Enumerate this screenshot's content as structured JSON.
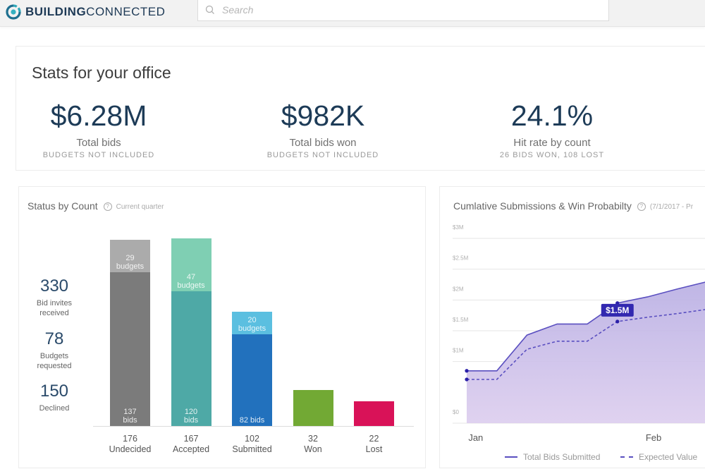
{
  "app": {
    "brand_bold": "BUILDING",
    "brand_light": "CONNECTED",
    "brand_color": "#1e3a56",
    "search_placeholder": "Search"
  },
  "stats": {
    "title": "Stats for your office",
    "items": [
      {
        "value": "$6.28M",
        "label": "Total bids",
        "sub": "BUDGETS NOT INCLUDED"
      },
      {
        "value": "$982K",
        "label": "Total bids won",
        "sub": "BUDGETS NOT INCLUDED"
      },
      {
        "value": "24.1%",
        "label": "Hit rate by count",
        "sub": "26 BIDS WON, 108 LOST"
      }
    ]
  },
  "status_card": {
    "title": "Status by Count",
    "help": "?",
    "subtitle": "Current quarter",
    "side_stats": [
      {
        "value": "330",
        "label_1": "Bid invites",
        "label_2": "received"
      },
      {
        "value": "78",
        "label_1": "Budgets",
        "label_2": "requested"
      },
      {
        "value": "150",
        "label_1": "Declined",
        "label_2": ""
      }
    ]
  },
  "cumulative_card": {
    "title": "Cumlative Submissions & Win Probabilty",
    "help": "?",
    "subtitle": "(7/1/2017 - Pr"
  },
  "chart_data": [
    {
      "type": "bar",
      "title": "Status by Count",
      "stacked": true,
      "categories": [
        "Undecided",
        "Accepted",
        "Submitted",
        "Won",
        "Lost"
      ],
      "totals": [
        176,
        167,
        102,
        32,
        22
      ],
      "series": [
        {
          "name": "bids",
          "values": [
            137,
            120,
            82,
            32,
            22
          ],
          "labels": [
            "137|bids",
            "120|bids",
            "82 bids",
            "",
            ""
          ]
        },
        {
          "name": "budgets",
          "values": [
            29,
            47,
            20,
            0,
            0
          ],
          "labels": [
            "29|budgets",
            "47|budgets",
            "20|budgets",
            "",
            ""
          ]
        }
      ],
      "colors": {
        "bids": [
          "#7b7b7b",
          "#4ea9a6",
          "#2271bd",
          "#72a934",
          "#d91258"
        ],
        "budgets": [
          "#ababab",
          "#7fcfb3",
          "#5bbfe0",
          "#72a934",
          "#d91258"
        ]
      },
      "ylim": [
        0,
        176
      ]
    },
    {
      "type": "area",
      "title": "Cumlative Submissions & Win Probabilty",
      "x": [
        0,
        1,
        2,
        3,
        4,
        5,
        6,
        7,
        8
      ],
      "xticks": [
        {
          "pos": 0.3,
          "label": "Jan"
        },
        {
          "pos": 6.2,
          "label": "Feb"
        }
      ],
      "yticks": [
        "$0",
        "$1M",
        "$1.5M",
        "$2M",
        "$2.5M",
        "$3M"
      ],
      "ytick_values": [
        0,
        1.0,
        1.5,
        2.0,
        2.5,
        3.0
      ],
      "ylim": [
        0,
        3.0
      ],
      "series": [
        {
          "name": "Total Bids Submitted",
          "style": "solid",
          "values": [
            0.85,
            0.85,
            1.43,
            1.61,
            1.61,
            1.95,
            2.05,
            2.18,
            2.3
          ]
        },
        {
          "name": "Expected Value",
          "style": "dashed",
          "values": [
            0.71,
            0.71,
            1.2,
            1.33,
            1.33,
            1.65,
            1.72,
            1.78,
            1.85
          ]
        }
      ],
      "tooltip": {
        "label": "$1.5M",
        "index": 5
      },
      "line_color": "#5a4fc0",
      "fill_color": "#c5b9e6",
      "dot_color": "#2a1fa8",
      "tooltip_color": "#3228b0"
    }
  ]
}
